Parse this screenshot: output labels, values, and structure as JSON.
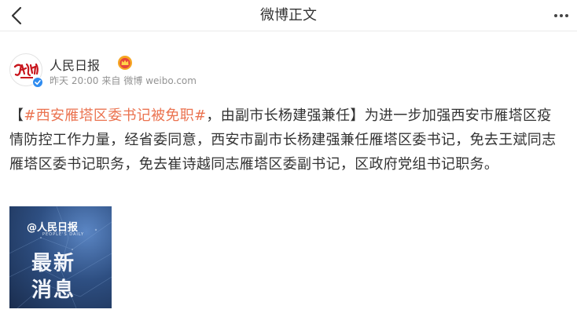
{
  "nav": {
    "title": "微博正文"
  },
  "author": {
    "name": "人民日报",
    "time": "昨天 20:00",
    "source_prefix": "来自",
    "source": "微博 weibo.com"
  },
  "post": {
    "bracket_open": "【",
    "topic": "#西安雁塔区委书记被免职#",
    "headline_rest": "，由副市长杨建强兼任】",
    "body": "为进一步加强西安市雁塔区疫情防控工作力量，经省委同意，西安市副市长杨建强兼任雁塔区委书记，免去王斌同志雁塔区委书记职务，免去崔诗越同志雁塔区委副书记，区政府党组书记职务。"
  },
  "image": {
    "brand": "@人民日报",
    "brand_sub": "PEOPLE'S DAILY",
    "line1": "最新",
    "line2": "消息"
  },
  "colors": {
    "topic": "#eb7350",
    "meta": "#939393",
    "text": "#333333"
  },
  "icons": [
    "back-arrow-icon",
    "more-dots-icon",
    "verified-badge-icon",
    "vip-crown-icon"
  ]
}
